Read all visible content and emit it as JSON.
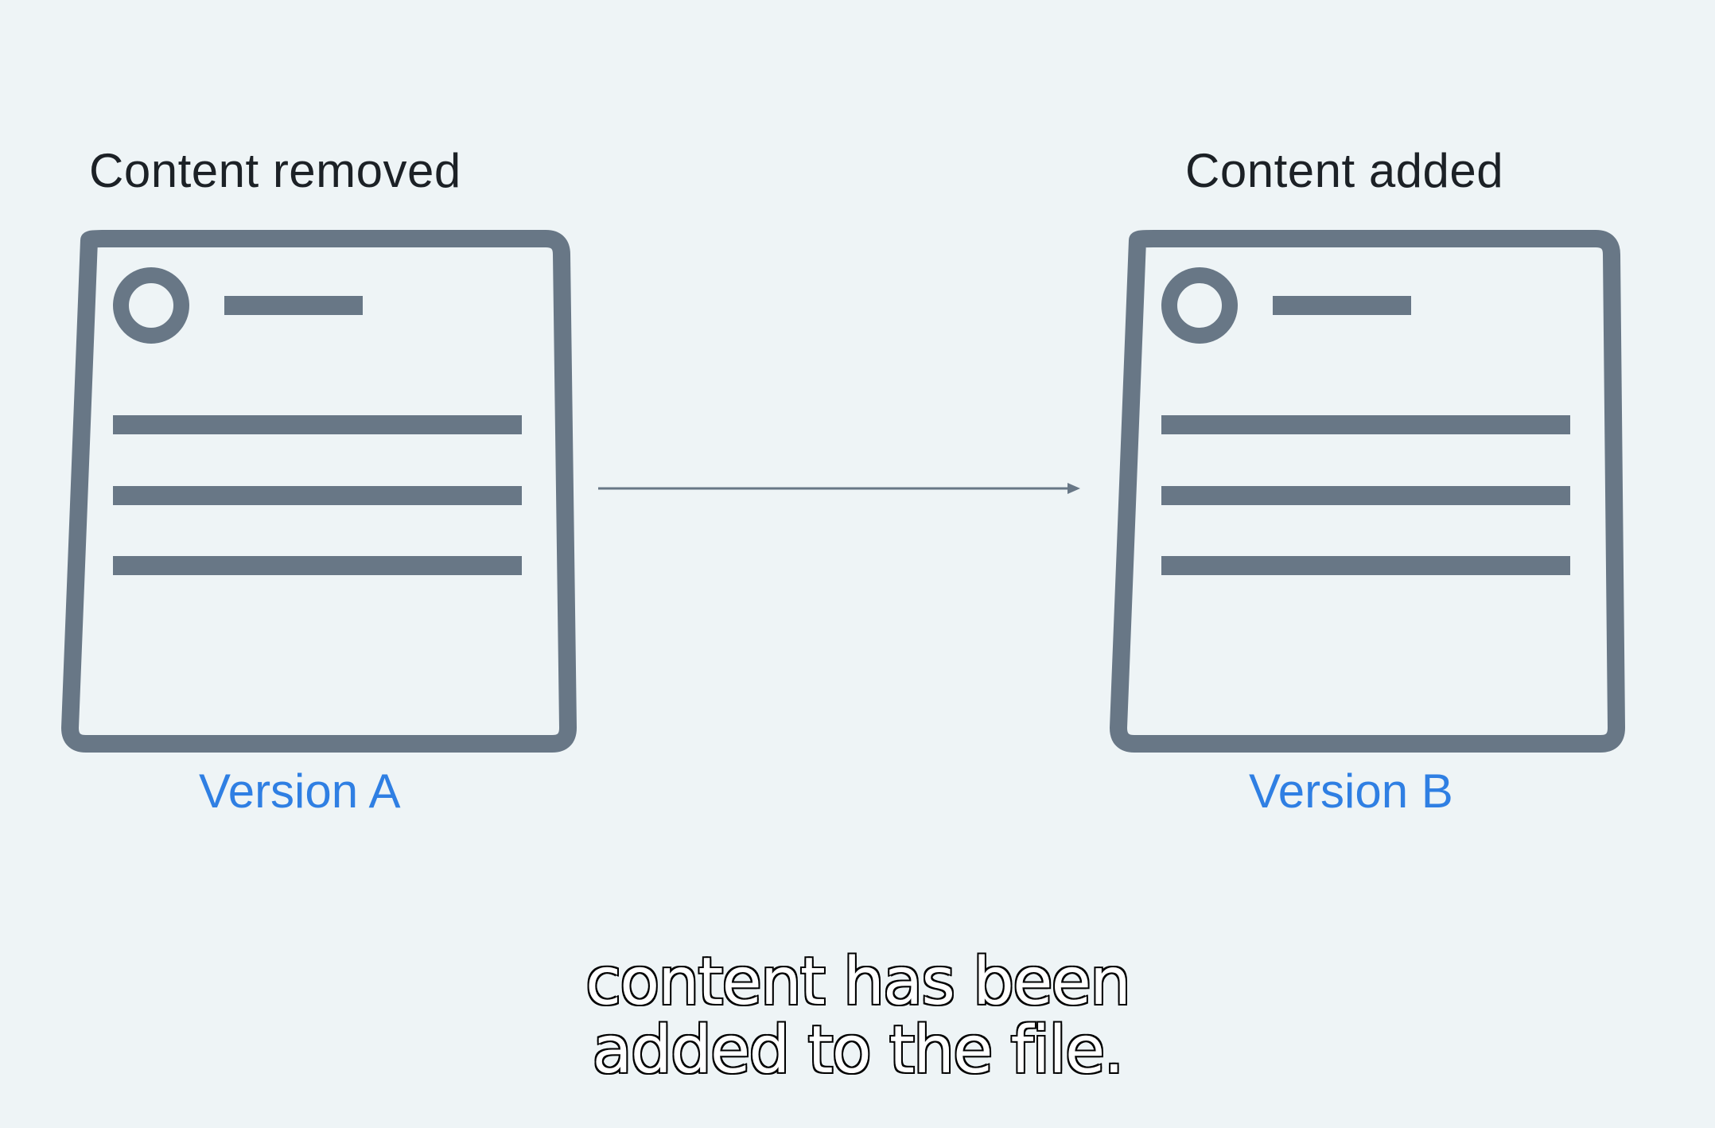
{
  "diagram": {
    "left_heading": "Content removed",
    "right_heading": "Content added",
    "left_version": "Version A",
    "right_version": "Version B"
  },
  "caption": {
    "line1": "content has been",
    "line2": "added to the file."
  },
  "colors": {
    "background": "#eef4f6",
    "document_stroke": "#687786",
    "version_label": "#2f7fe3",
    "heading_text": "#1c2126",
    "arrow": "#687786"
  },
  "icons": {
    "left_document": "document-icon",
    "right_document": "document-icon",
    "arrow": "right-arrow-icon"
  }
}
